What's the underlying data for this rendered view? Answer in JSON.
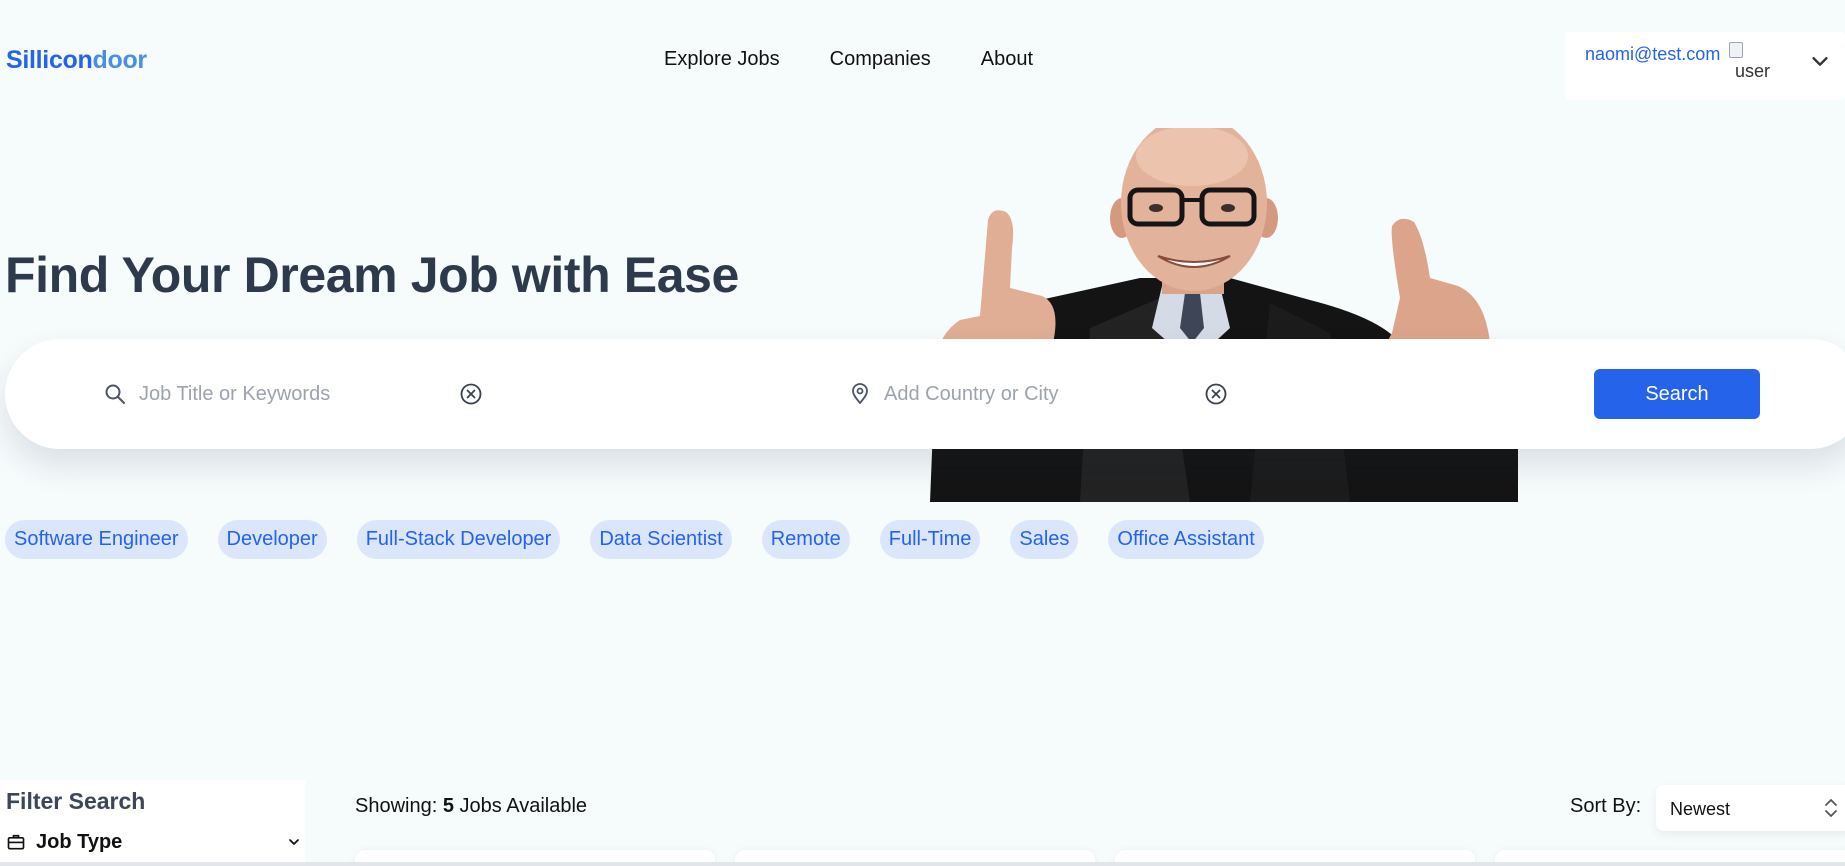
{
  "brand": {
    "part1": "Sillicon",
    "part2": "door"
  },
  "nav": {
    "explore": "Explore Jobs",
    "companies": "Companies",
    "about": "About"
  },
  "user": {
    "email": "naomi@test.com",
    "avatar_alt": "user"
  },
  "hero": {
    "title": "Find Your Dream Job with Ease"
  },
  "search": {
    "keywords_placeholder": "Job Title or Keywords",
    "location_placeholder": "Add Country or City",
    "button_label": "Search"
  },
  "tags": [
    "Software Engineer",
    "Developer",
    "Full-Stack Developer",
    "Data Scientist",
    "Remote",
    "Full-Time",
    "Sales",
    "Office Assistant"
  ],
  "filters": {
    "title": "Filter Search",
    "job_type_label": "Job Type"
  },
  "results": {
    "showing_label": "Showing:",
    "count": "5",
    "suffix": "Jobs Available",
    "sort_label": "Sort By:",
    "sort_value": "Newest"
  },
  "colors": {
    "primary": "#2563eb",
    "tag_bg": "#dbe6fa",
    "page_bg": "#f6fbfc",
    "heading": "#2d3a4b"
  }
}
